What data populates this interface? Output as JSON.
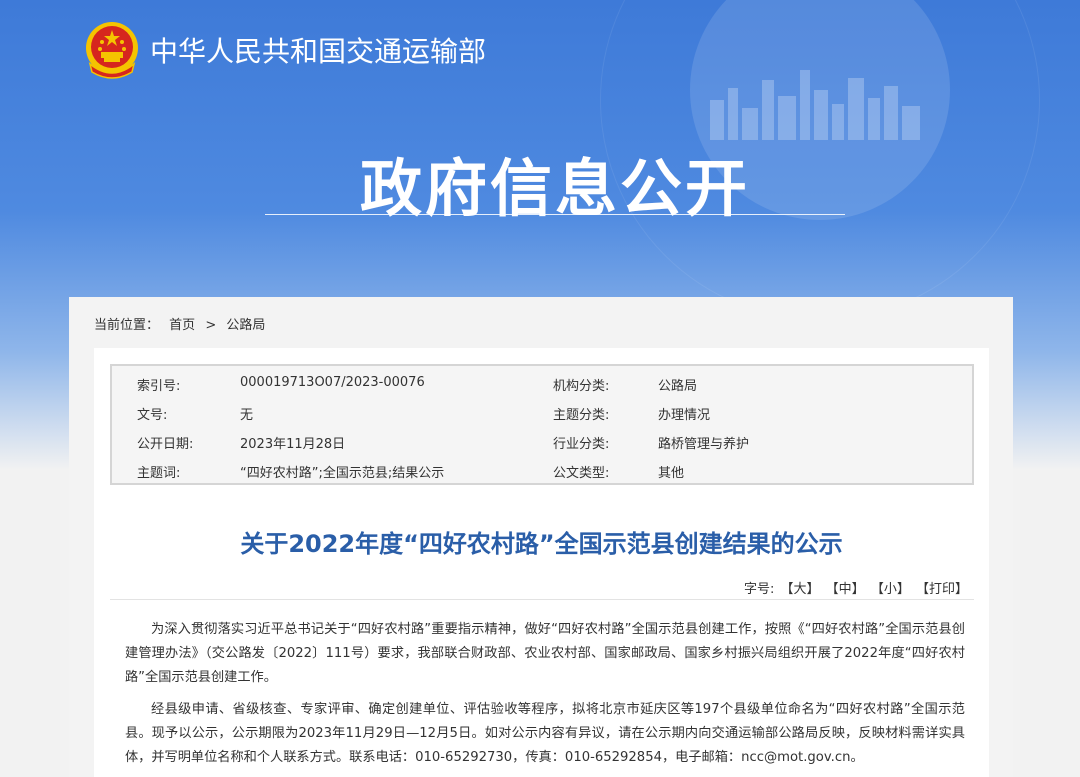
{
  "header": {
    "ministry_name": "中华人民共和国交通运输部",
    "hero_title": "政府信息公开"
  },
  "breadcrumb": {
    "label": "当前位置：",
    "home": "首页",
    "separator": ">",
    "current": "公路局"
  },
  "meta": {
    "rows": [
      {
        "k1": "索引号:",
        "v1": "000019713O07/2023-00076",
        "k2": "机构分类:",
        "v2": "公路局"
      },
      {
        "k1": "文号:",
        "v1": "无",
        "k2": "主题分类:",
        "v2": "办理情况"
      },
      {
        "k1": "公开日期:",
        "v1": "2023年11月28日",
        "k2": "行业分类:",
        "v2": "路桥管理与养护"
      },
      {
        "k1": "主题词:",
        "v1": "“四好农村路”;全国示范县;结果公示",
        "k2": "公文类型:",
        "v2": "其他"
      }
    ]
  },
  "document": {
    "title": "关于2022年度“四好农村路”全国示范县创建结果的公示",
    "fontsize_label": "字号:",
    "fontsize_large": "【大】",
    "fontsize_medium": "【中】",
    "fontsize_small": "【小】",
    "print": "【打印】",
    "paragraphs": [
      "为深入贯彻落实习近平总书记关于“四好农村路”重要指示精神，做好“四好农村路”全国示范县创建工作，按照《“四好农村路”全国示范县创建管理办法》（交公路发〔2022〕111号）要求，我部联合财政部、农业农村部、国家邮政局、国家乡村振兴局组织开展了2022年度“四好农村路”全国示范县创建工作。",
      "经县级申请、省级核查、专家评审、确定创建单位、评估验收等程序，拟将北京市延庆区等197个县级单位命名为“四好农村路”全国示范县。现予以公示，公示期限为2023年11月29日—12月5日。如对公示内容有异议，请在公示期内向交通运输部公路局反映，反映材料需详实具体，并写明单位名称和个人联系方式。联系电话：010-65292730，传真：010-65292854，电子邮箱：ncc@mot.gov.cn。"
    ]
  },
  "colors": {
    "banner_blue": "#3e7ad8",
    "title_blue": "#2a5ea8",
    "emblem_red": "#d6261e",
    "emblem_gold": "#f5c400"
  }
}
